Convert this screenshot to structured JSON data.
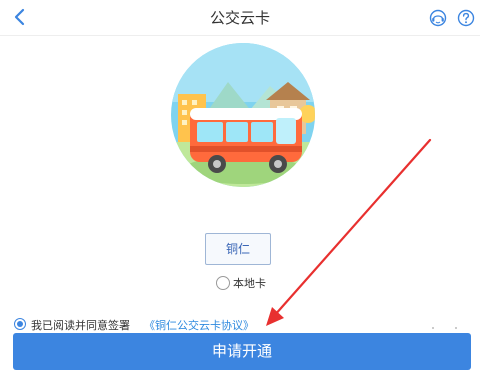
{
  "header": {
    "title": "公交云卡",
    "back_icon": "chevron-left-icon",
    "right_icons": [
      "customer-service-icon",
      "help-question-icon"
    ]
  },
  "illustration": {
    "description_icon": "bus-city-illustration"
  },
  "city_selector": {
    "label": "铜仁"
  },
  "local_card": {
    "label": "本地卡",
    "selected": false
  },
  "agreement": {
    "text": "我已阅读并同意签署",
    "link": "《铜仁公交云卡协议》",
    "checked": true
  },
  "apply_button": {
    "label": "申请开通"
  },
  "colors": {
    "primary_blue": "#3c85e0",
    "link_blue": "#2e8adf",
    "annotation_red": "#e8302f",
    "bus_orange": "#ff6a3c",
    "circle_sky": "#7fd3ef"
  }
}
